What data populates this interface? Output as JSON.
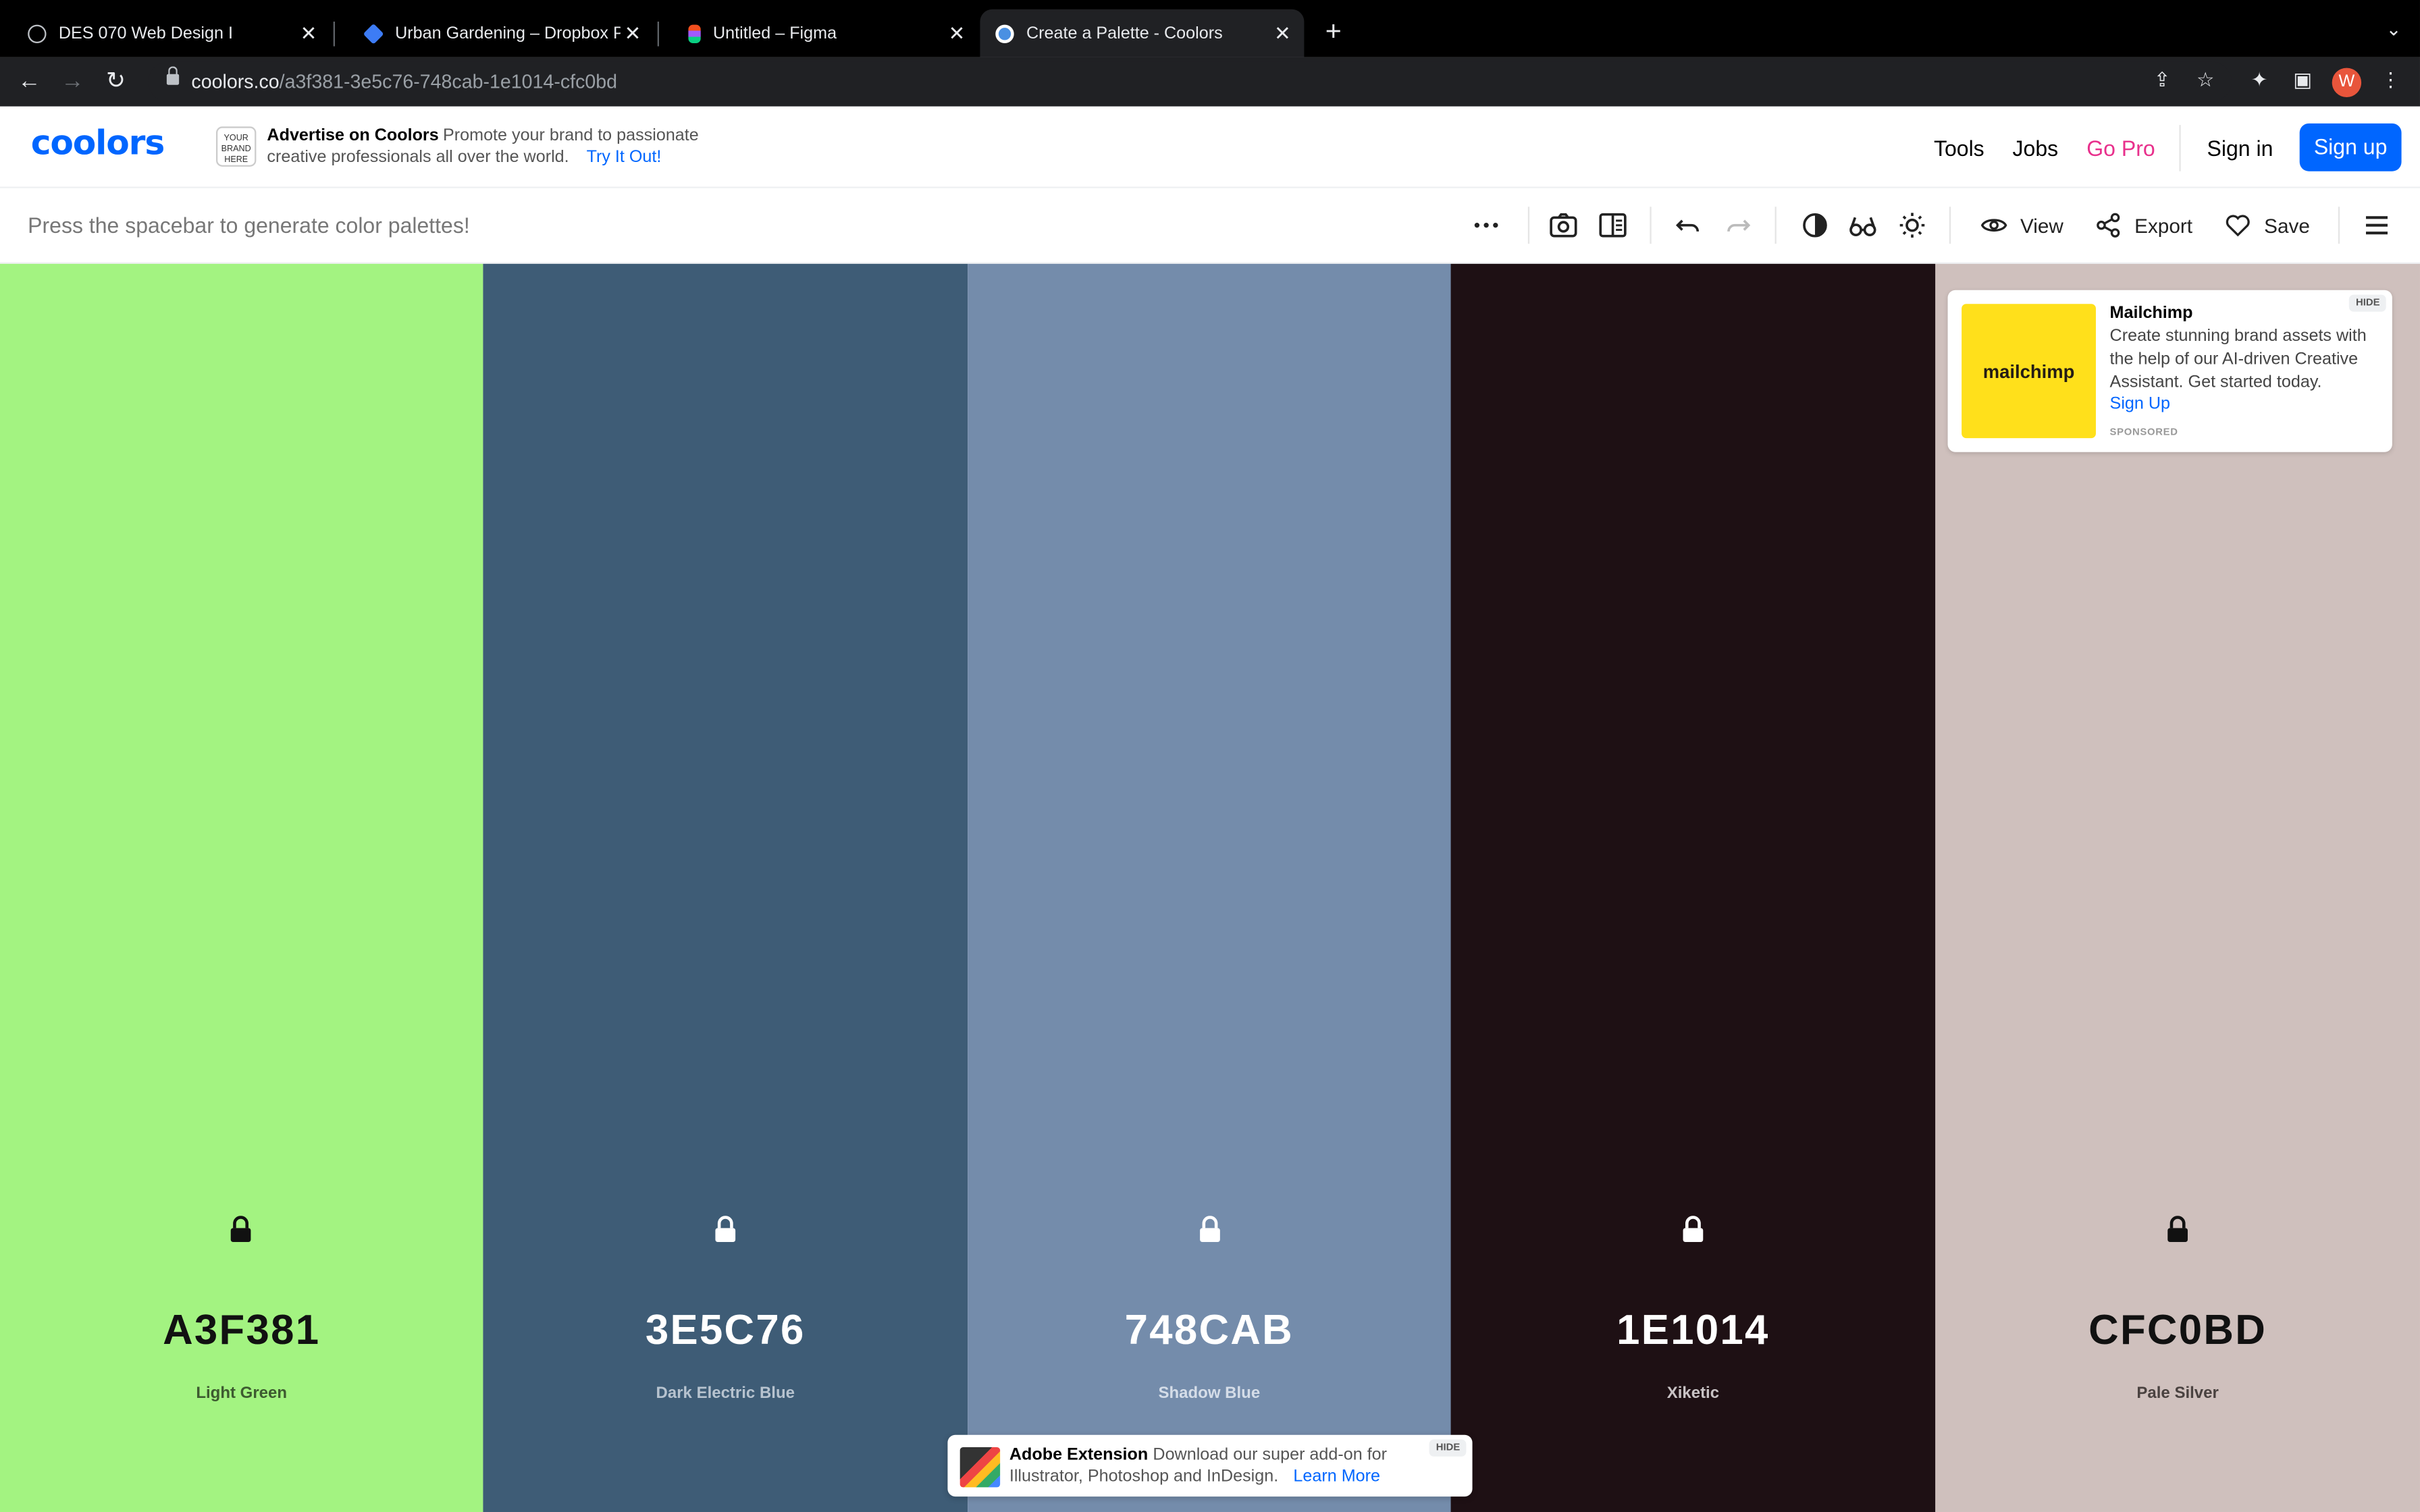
{
  "browser": {
    "tabs": [
      {
        "title": "DES 070 Web Design I",
        "active": false
      },
      {
        "title": "Urban Gardening – Dropbox Pa",
        "active": false
      },
      {
        "title": "Untitled – Figma",
        "active": false
      },
      {
        "title": "Create a Palette - Coolors",
        "active": true
      }
    ],
    "url_host": "coolors.co",
    "url_path": "/a3f381-3e5c76-748cab-1e1014-cfc0bd",
    "profile_initial": "W"
  },
  "header": {
    "logo": "coolors",
    "brand_box": "YOUR BRAND HERE",
    "advertise_title": "Advertise on Coolors",
    "advertise_desc_1": "Promote your brand to passionate",
    "advertise_desc_2": "creative professionals all over the world.",
    "advertise_link": "Try It Out!",
    "nav": {
      "tools": "Tools",
      "jobs": "Jobs",
      "go_pro": "Go Pro",
      "sign_in": "Sign in",
      "sign_up": "Sign up"
    }
  },
  "toolbar": {
    "hint": "Press the spacebar to generate color palettes!",
    "view_label": "View",
    "export_label": "Export",
    "save_label": "Save"
  },
  "palette": [
    {
      "hex": "A3F381",
      "name": "Light Green",
      "color": "#a3f381",
      "text_color": "#111111",
      "name_color": "#3d5a30"
    },
    {
      "hex": "3E5C76",
      "name": "Dark Electric Blue",
      "color": "#3e5c76",
      "text_color": "#ffffff",
      "name_color": "#b7c3cf"
    },
    {
      "hex": "748CAB",
      "name": "Shadow Blue",
      "color": "#748cab",
      "text_color": "#ffffff",
      "name_color": "#d5dde8"
    },
    {
      "hex": "1E1014",
      "name": "Xiketic",
      "color": "#1e1014",
      "text_color": "#ffffff",
      "name_color": "#c9c3c5"
    },
    {
      "hex": "CFC0BD",
      "name": "Pale Silver",
      "color": "#cfc0bd",
      "text_color": "#111111",
      "name_color": "#4a4240"
    }
  ],
  "ad": {
    "image_text": "mailchimp",
    "brand": "Mailchimp",
    "text": "Create stunning brand assets with the help of our AI-driven Creative Assistant. Get started today.",
    "cta": "Sign Up",
    "sponsored": "SPONSORED",
    "hide": "HIDE"
  },
  "extension": {
    "title": "Adobe Extension",
    "desc_1": "Download our super add-on for",
    "desc_2": "Illustrator, Photoshop and InDesign.",
    "link": "Learn More",
    "hide": "HIDE"
  }
}
